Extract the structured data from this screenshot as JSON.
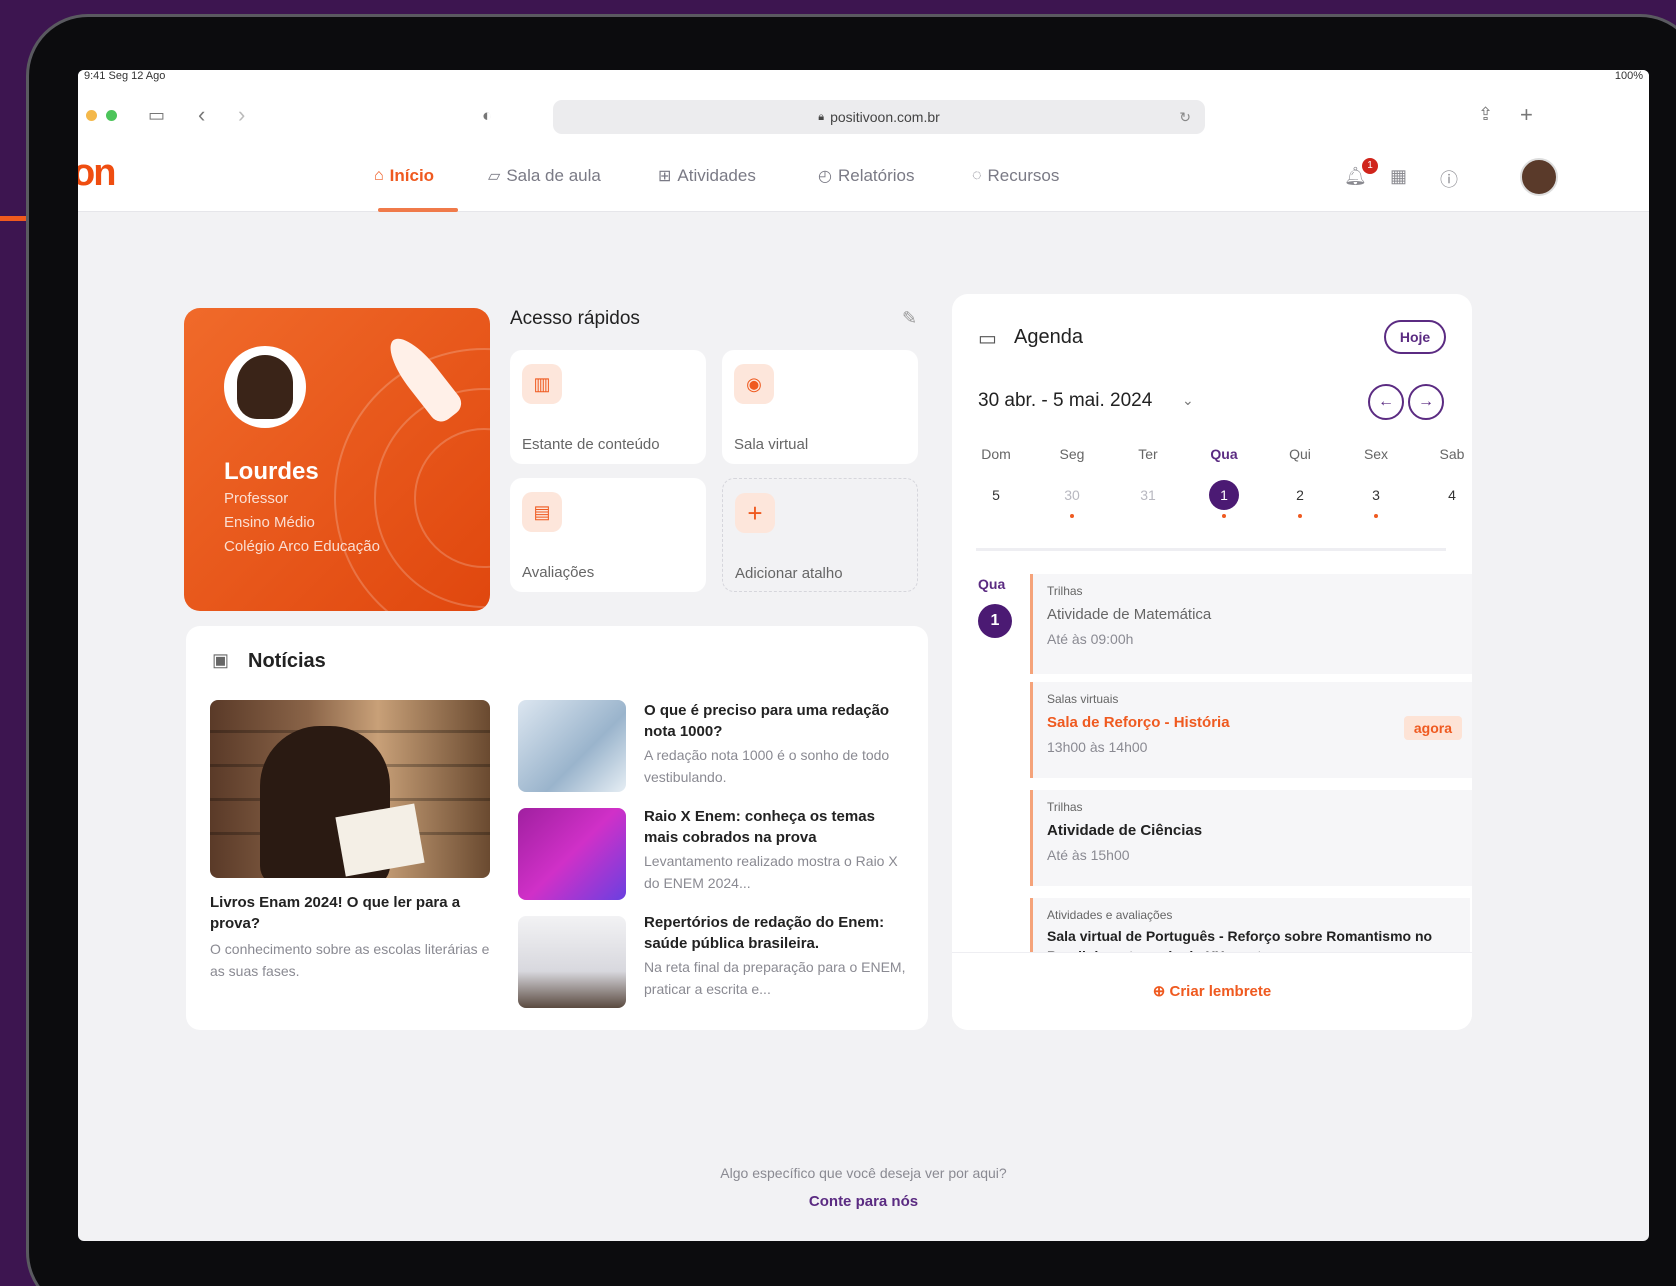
{
  "status": {
    "time": "9:41",
    "date": "Seg 12 Ago",
    "battery": "100%"
  },
  "browser": {
    "url": "positivoon.com.br"
  },
  "app": {
    "logo": "on"
  },
  "nav": {
    "items": [
      {
        "label": "Início",
        "icon": "home-icon"
      },
      {
        "label": "Sala de aula",
        "icon": "classroom-icon"
      },
      {
        "label": "Atividades",
        "icon": "activities-icon"
      },
      {
        "label": "Relatórios",
        "icon": "reports-icon"
      },
      {
        "label": "Recursos",
        "icon": "resources-icon"
      }
    ],
    "notification_count": "1"
  },
  "profile": {
    "name": "Lourdes",
    "role": "Professor",
    "level": "Ensino Médio",
    "school": "Colégio Arco Educação"
  },
  "quick_access": {
    "title": "Acesso rápidos",
    "items": [
      {
        "label": "Estante de conteúdo",
        "icon": "bookshelf-icon"
      },
      {
        "label": "Sala virtual",
        "icon": "virtual-room-icon"
      },
      {
        "label": "Avaliações",
        "icon": "assessment-icon"
      },
      {
        "label": "Adicionar atalho",
        "icon": "plus-icon"
      }
    ]
  },
  "news": {
    "title": "Notícias",
    "featured": {
      "title": "Livros Enam 2024! O que ler para a prova?",
      "desc": "O conhecimento sobre as escolas literárias e as suas fases."
    },
    "items": [
      {
        "title": "O que é preciso para uma redação nota 1000?",
        "desc": "A redação nota 1000 é o sonho de todo vestibulando."
      },
      {
        "title": "Raio X Enem: conheça os temas mais cobrados na prova",
        "desc": "Levantamento realizado mostra o Raio X do ENEM 2024..."
      },
      {
        "title": "Repertórios de redação do Enem: saúde pública brasileira.",
        "desc": "Na reta final da preparação para o ENEM, praticar a escrita e..."
      }
    ]
  },
  "agenda": {
    "title": "Agenda",
    "today_button": "Hoje",
    "range": "30 abr. - 5 mai. 2024",
    "days": [
      {
        "name": "Dom",
        "num": "5",
        "muted": false,
        "current": false,
        "dot": false
      },
      {
        "name": "Seg",
        "num": "30",
        "muted": true,
        "current": false,
        "dot": true
      },
      {
        "name": "Ter",
        "num": "31",
        "muted": true,
        "current": false,
        "dot": false
      },
      {
        "name": "Qua",
        "num": "1",
        "muted": false,
        "current": true,
        "dot": true
      },
      {
        "name": "Qui",
        "num": "2",
        "muted": false,
        "current": false,
        "dot": true
      },
      {
        "name": "Sex",
        "num": "3",
        "muted": false,
        "current": false,
        "dot": true
      },
      {
        "name": "Sab",
        "num": "4",
        "muted": false,
        "current": false,
        "dot": false
      }
    ],
    "selected_day_label": "Qua",
    "selected_day_num": "1",
    "events": [
      {
        "category": "Trilhas",
        "title": "Atividade de Matemática",
        "time": "Até às 09:00h",
        "style": "plain"
      },
      {
        "category": "Salas virtuais",
        "title": "Sala de Reforço - História",
        "time": "13h00 às 14h00",
        "style": "live",
        "badge": "agora"
      },
      {
        "category": "Trilhas",
        "title": "Atividade de Ciências",
        "time": "Até às 15h00",
        "style": "bold"
      },
      {
        "category": "Atividades e avaliações",
        "title": "Sala virtual de Português - Reforço sobre Romantismo no Brasil durante o século XX e outr...",
        "time": "",
        "style": "bold"
      }
    ],
    "create_reminder": "Criar lembrete"
  },
  "footer": {
    "question": "Algo específico que você deseja ver por aqui?",
    "link": "Conte para nós"
  },
  "colors": {
    "brand": "#ef5a20",
    "accent": "#4b1a73",
    "background": "#3d1550"
  }
}
